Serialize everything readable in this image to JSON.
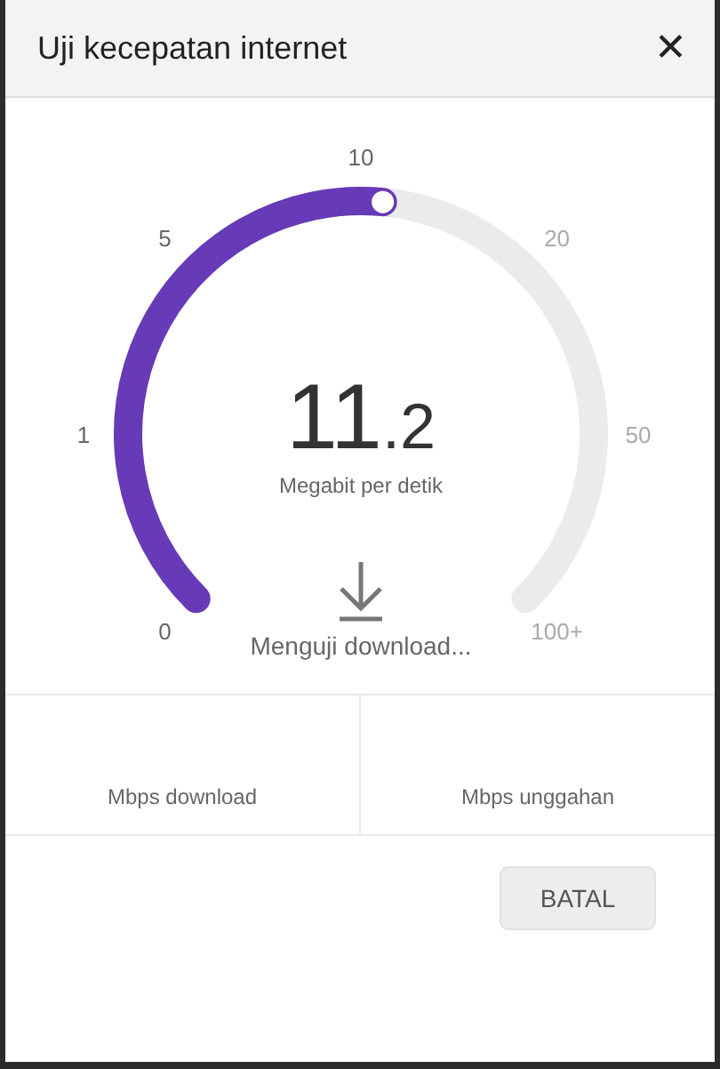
{
  "dialog": {
    "title": "Uji kecepatan internet",
    "close": "✕"
  },
  "gauge": {
    "ticks": [
      "0",
      "1",
      "5",
      "10",
      "20",
      "50",
      "100+"
    ],
    "value_whole": "11",
    "value_fraction": ".2",
    "unit": "Megabit per detik",
    "status": "Menguji download..."
  },
  "results": [
    {
      "label": "Mbps download"
    },
    {
      "label": "Mbps unggahan"
    }
  ],
  "buttons": [
    {
      "label": "BATAL",
      "disabled": false
    }
  ]
}
